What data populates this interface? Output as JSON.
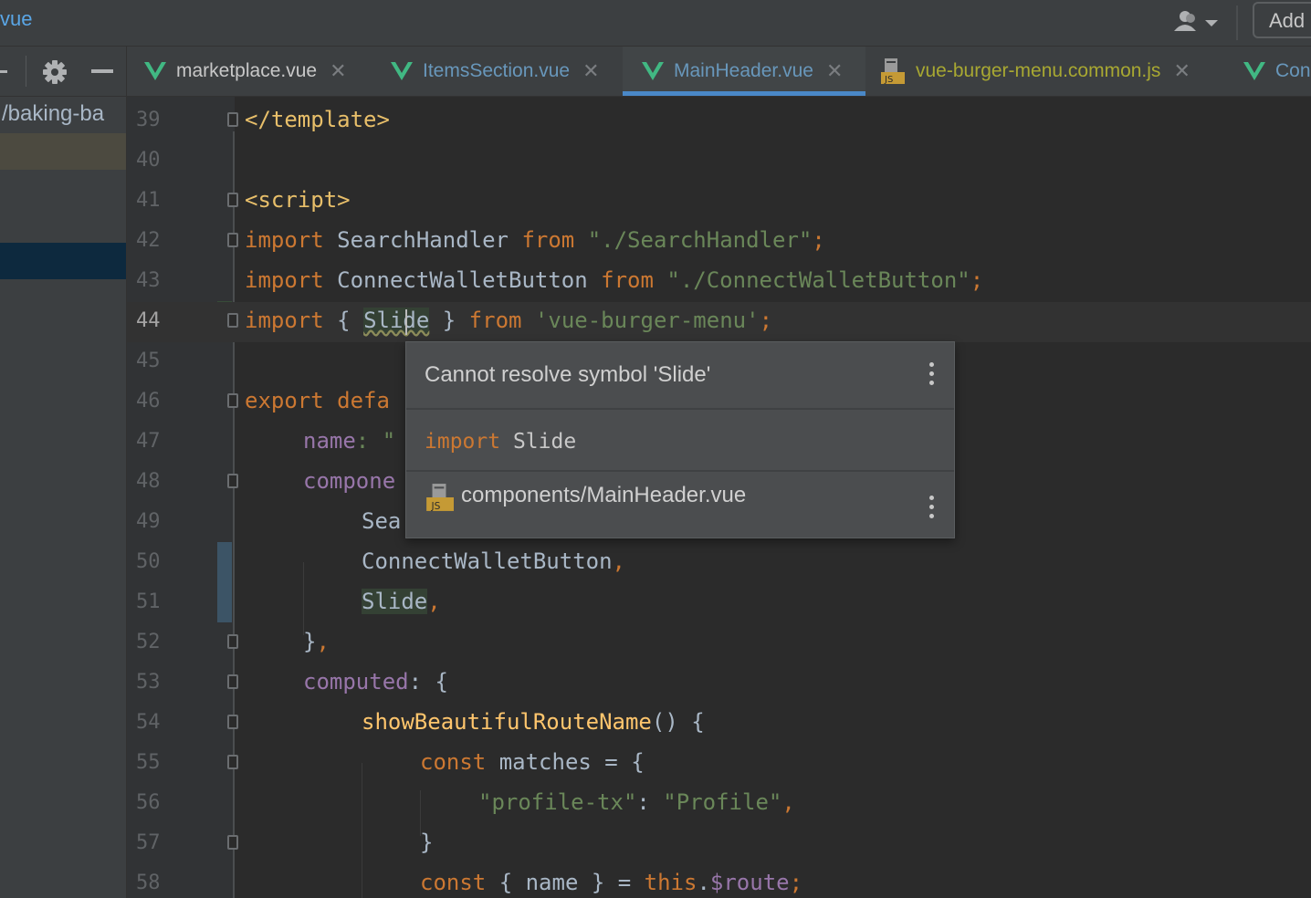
{
  "topbar": {
    "breadcrumb": "vue",
    "user_icon": "user-dropdown-icon",
    "add_button": "Add"
  },
  "left_panel": {
    "path_text": "/baking-ba",
    "icons": [
      "collapse-icon",
      "gear-icon",
      "minimize-icon"
    ]
  },
  "tabs": [
    {
      "label": "marketplace.vue",
      "icon": "vue-icon",
      "color": "#c8c8c8",
      "active": false
    },
    {
      "label": "ItemsSection.vue",
      "icon": "vue-icon",
      "color": "#6897bb",
      "active": false
    },
    {
      "label": "MainHeader.vue",
      "icon": "vue-icon",
      "color": "#6897bb",
      "active": true
    },
    {
      "label": "vue-burger-menu.common.js",
      "icon": "js-file-icon",
      "color": "#a8a832",
      "active": false
    },
    {
      "label": "Con",
      "icon": "vue-icon",
      "color": "#6897bb",
      "active": false
    }
  ],
  "editor": {
    "line_numbers": [
      "39",
      "40",
      "41",
      "42",
      "43",
      "44",
      "45",
      "46",
      "47",
      "48",
      "49",
      "50",
      "51",
      "52",
      "53",
      "54",
      "55",
      "56",
      "57",
      "58"
    ],
    "current_line": "44"
  },
  "code": {
    "l39_tag": "</template>",
    "l41_tag": "<script>",
    "l42_import": "import",
    "l42_name": " SearchHandler ",
    "l42_from": "from",
    "l42_str": " \"./SearchHandler\"",
    "l42_semi": ";",
    "l43_import": "import",
    "l43_name": " ConnectWalletButton ",
    "l43_from": "from",
    "l43_str": " \"./ConnectWalletButton\"",
    "l43_semi": ";",
    "l44_import": "import",
    "l44_brace_open": " { ",
    "l44_slide": "Slide",
    "l44_brace_close": " } ",
    "l44_from": "from",
    "l44_str": " 'vue-burger-menu'",
    "l44_semi": ";",
    "l46_export": "export defa",
    "l47_name": "name",
    "l47_rest": ": \"",
    "l48_comp": "compone",
    "l49_text": "Sea",
    "l50_text": "ConnectWalletButton",
    "l50_comma": ",",
    "l51_text": "Slide",
    "l51_comma": ",",
    "l52_close": "}",
    "l52_comma": ",",
    "l53_computed": "computed",
    "l53_rest": ": {",
    "l54_fn": "showBeautifulRouteName",
    "l54_rest": "() {",
    "l55_const": "const",
    "l55_rest": " matches = {",
    "l56_key": "\"profile-tx\"",
    "l56_colon": ": ",
    "l56_val": "\"Profile\"",
    "l56_comma": ",",
    "l57_close": "}",
    "l58_const": "const",
    "l58_mid": " { name } = ",
    "l58_this": "this",
    "l58_dot": ".",
    "l58_route": "$route",
    "l58_semi": ";"
  },
  "popup": {
    "title": "Cannot resolve symbol 'Slide'",
    "action_keyword": "import",
    "action_name": " Slide",
    "file": "components/MainHeader.vue",
    "file_icon": "js-file-icon",
    "menu_icon": "more-vertical-icon"
  }
}
